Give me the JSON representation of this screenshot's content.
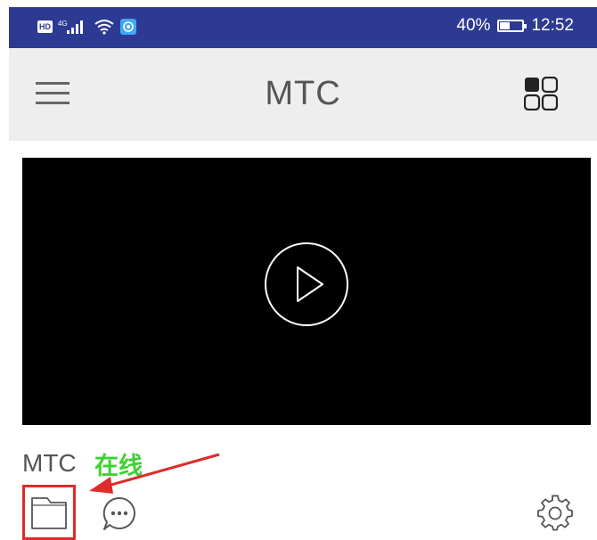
{
  "status_bar": {
    "hd_badge": "HD",
    "network_type": "4G",
    "battery_percent": "40%",
    "battery_level": 0.4,
    "time": "12:52",
    "icons": [
      "hd-icon",
      "signal-icon",
      "wifi-icon",
      "app-notification-icon",
      "battery-icon"
    ]
  },
  "app_bar": {
    "title": "MTC",
    "left_icon": "hamburger-menu-icon",
    "right_icon": "grid-view-icon"
  },
  "video": {
    "play_icon": "play-icon"
  },
  "device": {
    "name": "MTC",
    "status": "在线",
    "status_color": "#3cd232"
  },
  "actions": {
    "folder_icon": "folder-icon",
    "chat_icon": "chat-icon",
    "settings_icon": "settings-icon"
  },
  "annotation": {
    "highlight_color": "#e02b2b"
  },
  "colors": {
    "status_bar_bg": "#2d3a93",
    "app_bar_bg": "#eeeeee",
    "video_bg": "#000000"
  }
}
